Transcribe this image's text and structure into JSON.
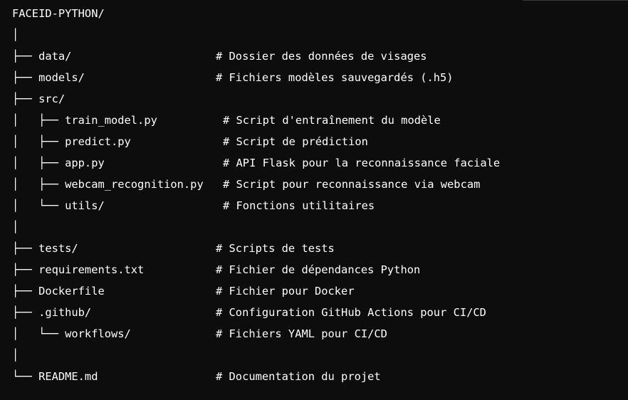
{
  "tree": {
    "root": "FACEID-PYTHON/",
    "lines": [
      {
        "text": "│",
        "comment": ""
      },
      {
        "text": "├── data/",
        "comment": "# Dossier des données de visages"
      },
      {
        "text": "├── models/",
        "comment": "# Fichiers modèles sauvegardés (.h5)"
      },
      {
        "text": "├── src/",
        "comment": ""
      },
      {
        "text": "│   ├── train_model.py",
        "comment": "# Script d'entraînement du modèle"
      },
      {
        "text": "│   ├── predict.py",
        "comment": "# Script de prédiction"
      },
      {
        "text": "│   ├── app.py",
        "comment": "# API Flask pour la reconnaissance faciale"
      },
      {
        "text": "│   ├── webcam_recognition.py",
        "comment": "# Script pour reconnaissance via webcam"
      },
      {
        "text": "│   └── utils/",
        "comment": "# Fonctions utilitaires"
      },
      {
        "text": "│",
        "comment": ""
      },
      {
        "text": "├── tests/",
        "comment": "# Scripts de tests"
      },
      {
        "text": "├── requirements.txt",
        "comment": "# Fichier de dépendances Python"
      },
      {
        "text": "├── Dockerfile",
        "comment": "# Fichier pour Docker"
      },
      {
        "text": "├── .github/",
        "comment": "# Configuration GitHub Actions pour CI/CD"
      },
      {
        "text": "│   └── workflows/",
        "comment": "# Fichiers YAML pour CI/CD"
      },
      {
        "text": "│",
        "comment": ""
      },
      {
        "text": "└── README.md",
        "comment": "# Documentation du projet"
      }
    ]
  },
  "colors": {
    "background": "#0d0d0d",
    "text": "#ffffff"
  }
}
